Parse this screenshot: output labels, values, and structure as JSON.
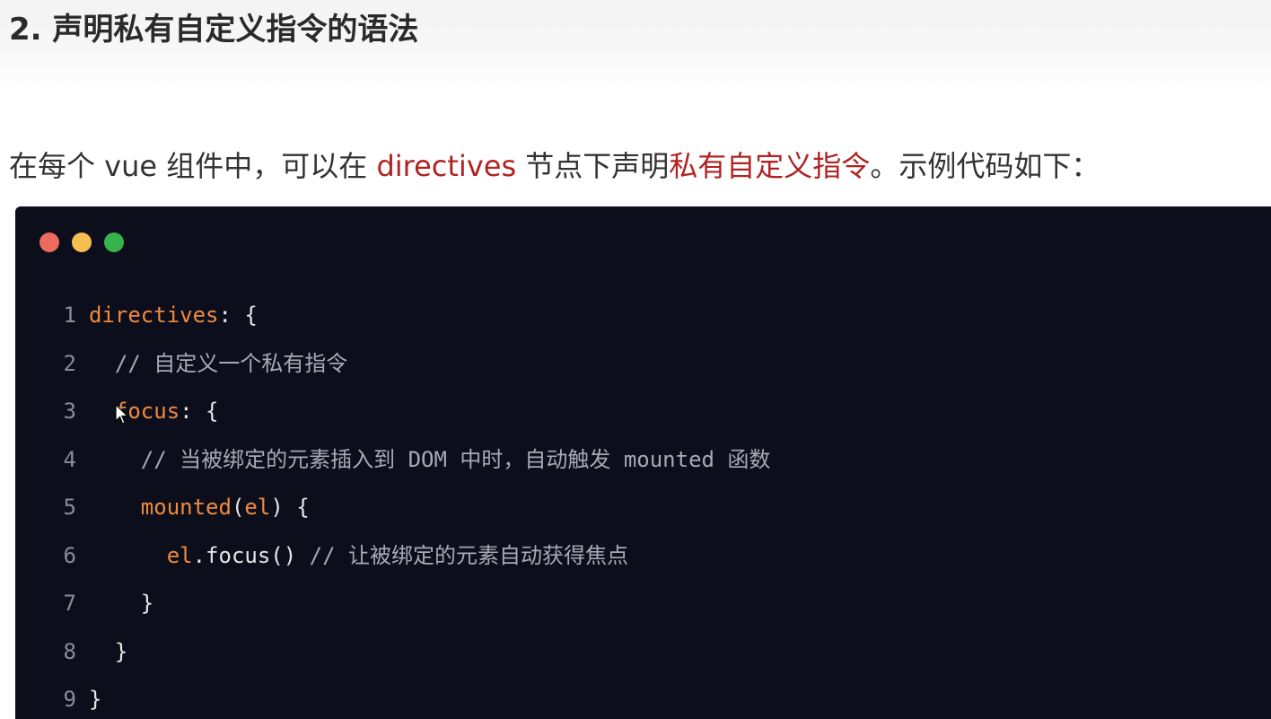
{
  "heading": "2. 声明私有自定义指令的语法",
  "intro": {
    "before": "在每个 vue 组件中，可以在 ",
    "keyword": "directives",
    "middle": " 节点下声明",
    "highlight": "私有自定义指令",
    "after": "。示例代码如下："
  },
  "code_window": {
    "dot_colors": [
      "#ed6a5e",
      "#f5bf4f",
      "#34b44a"
    ],
    "lines": [
      {
        "n": "1",
        "indent": "",
        "a": "directives",
        "b": ": {",
        "c": ""
      },
      {
        "n": "2",
        "indent": "  ",
        "a": "",
        "b": "",
        "c": "// 自定义一个私有指令"
      },
      {
        "n": "3",
        "indent": "  ",
        "a": "focus",
        "b": ": {",
        "c": ""
      },
      {
        "n": "4",
        "indent": "    ",
        "a": "",
        "b": "",
        "c": "// 当被绑定的元素插入到 DOM 中时，自动触发 mounted 函数"
      },
      {
        "n": "5",
        "indent": "    ",
        "a": "mounted",
        "b": "(",
        "a2": "el",
        "b2": ") {",
        "c": ""
      },
      {
        "n": "6",
        "indent": "      ",
        "a": "el",
        "b": ".focus() ",
        "c": "// 让被绑定的元素自动获得焦点"
      },
      {
        "n": "7",
        "indent": "    ",
        "a": "",
        "b": "}",
        "c": ""
      },
      {
        "n": "8",
        "indent": "  ",
        "a": "",
        "b": "}",
        "c": ""
      },
      {
        "n": "9",
        "indent": "",
        "a": "",
        "b": "}",
        "c": ""
      }
    ]
  },
  "cursor_icon": "mouse-pointer-icon"
}
